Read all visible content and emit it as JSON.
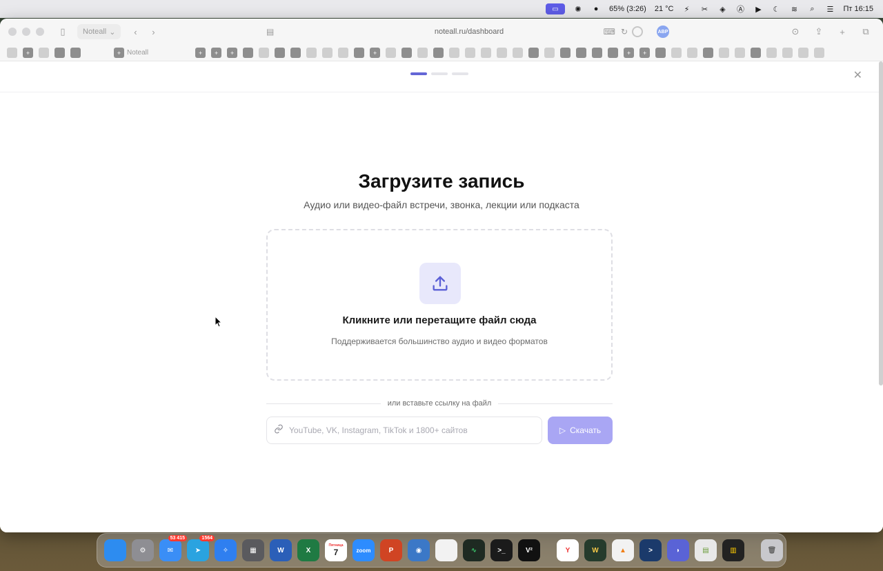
{
  "menubar": {
    "battery": "65% (3:26)",
    "weather": "21 °C",
    "clock": "Пт 16:15"
  },
  "browser": {
    "profile_label": "Noteall",
    "url": "noteall.ru/dashboard",
    "ext_abp": "ABP",
    "bookmark_label": "Noteall"
  },
  "page": {
    "title": "Загрузите запись",
    "subtitle": "Аудио или видео-файл встречи, звонка, лекции или подкаста",
    "dropzone_title": "Кликните или перетащите файл сюда",
    "dropzone_subtitle": "Поддерживается большинство аудио и видео форматов",
    "or_text": "или вставьте ссылку на файл",
    "url_placeholder": "YouTube, VK, Instagram, TikTok и 1800+ сайтов",
    "download_label": "Скачать"
  },
  "dock": {
    "mail_badge": "53 415",
    "telegram_badge": "1564",
    "calendar_day": "7",
    "calendar_month": "Пятница",
    "zoom_label": "zoom"
  },
  "colors": {
    "accent": "#6366d6",
    "button": "#a9a6f4",
    "upload_tile": "#e8e8fb"
  }
}
